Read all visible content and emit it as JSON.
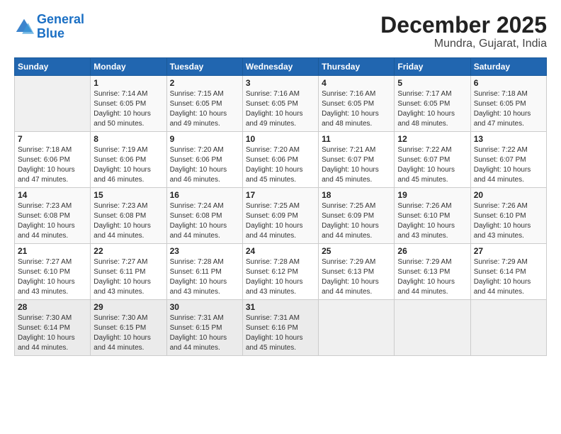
{
  "header": {
    "logo_line1": "General",
    "logo_line2": "Blue",
    "title": "December 2025",
    "subtitle": "Mundra, Gujarat, India"
  },
  "days_of_week": [
    "Sunday",
    "Monday",
    "Tuesday",
    "Wednesday",
    "Thursday",
    "Friday",
    "Saturday"
  ],
  "weeks": [
    [
      {
        "day": "",
        "info": ""
      },
      {
        "day": "1",
        "info": "Sunrise: 7:14 AM\nSunset: 6:05 PM\nDaylight: 10 hours\nand 50 minutes."
      },
      {
        "day": "2",
        "info": "Sunrise: 7:15 AM\nSunset: 6:05 PM\nDaylight: 10 hours\nand 49 minutes."
      },
      {
        "day": "3",
        "info": "Sunrise: 7:16 AM\nSunset: 6:05 PM\nDaylight: 10 hours\nand 49 minutes."
      },
      {
        "day": "4",
        "info": "Sunrise: 7:16 AM\nSunset: 6:05 PM\nDaylight: 10 hours\nand 48 minutes."
      },
      {
        "day": "5",
        "info": "Sunrise: 7:17 AM\nSunset: 6:05 PM\nDaylight: 10 hours\nand 48 minutes."
      },
      {
        "day": "6",
        "info": "Sunrise: 7:18 AM\nSunset: 6:05 PM\nDaylight: 10 hours\nand 47 minutes."
      }
    ],
    [
      {
        "day": "7",
        "info": "Sunrise: 7:18 AM\nSunset: 6:06 PM\nDaylight: 10 hours\nand 47 minutes."
      },
      {
        "day": "8",
        "info": "Sunrise: 7:19 AM\nSunset: 6:06 PM\nDaylight: 10 hours\nand 46 minutes."
      },
      {
        "day": "9",
        "info": "Sunrise: 7:20 AM\nSunset: 6:06 PM\nDaylight: 10 hours\nand 46 minutes."
      },
      {
        "day": "10",
        "info": "Sunrise: 7:20 AM\nSunset: 6:06 PM\nDaylight: 10 hours\nand 45 minutes."
      },
      {
        "day": "11",
        "info": "Sunrise: 7:21 AM\nSunset: 6:07 PM\nDaylight: 10 hours\nand 45 minutes."
      },
      {
        "day": "12",
        "info": "Sunrise: 7:22 AM\nSunset: 6:07 PM\nDaylight: 10 hours\nand 45 minutes."
      },
      {
        "day": "13",
        "info": "Sunrise: 7:22 AM\nSunset: 6:07 PM\nDaylight: 10 hours\nand 44 minutes."
      }
    ],
    [
      {
        "day": "14",
        "info": "Sunrise: 7:23 AM\nSunset: 6:08 PM\nDaylight: 10 hours\nand 44 minutes."
      },
      {
        "day": "15",
        "info": "Sunrise: 7:23 AM\nSunset: 6:08 PM\nDaylight: 10 hours\nand 44 minutes."
      },
      {
        "day": "16",
        "info": "Sunrise: 7:24 AM\nSunset: 6:08 PM\nDaylight: 10 hours\nand 44 minutes."
      },
      {
        "day": "17",
        "info": "Sunrise: 7:25 AM\nSunset: 6:09 PM\nDaylight: 10 hours\nand 44 minutes."
      },
      {
        "day": "18",
        "info": "Sunrise: 7:25 AM\nSunset: 6:09 PM\nDaylight: 10 hours\nand 44 minutes."
      },
      {
        "day": "19",
        "info": "Sunrise: 7:26 AM\nSunset: 6:10 PM\nDaylight: 10 hours\nand 43 minutes."
      },
      {
        "day": "20",
        "info": "Sunrise: 7:26 AM\nSunset: 6:10 PM\nDaylight: 10 hours\nand 43 minutes."
      }
    ],
    [
      {
        "day": "21",
        "info": "Sunrise: 7:27 AM\nSunset: 6:10 PM\nDaylight: 10 hours\nand 43 minutes."
      },
      {
        "day": "22",
        "info": "Sunrise: 7:27 AM\nSunset: 6:11 PM\nDaylight: 10 hours\nand 43 minutes."
      },
      {
        "day": "23",
        "info": "Sunrise: 7:28 AM\nSunset: 6:11 PM\nDaylight: 10 hours\nand 43 minutes."
      },
      {
        "day": "24",
        "info": "Sunrise: 7:28 AM\nSunset: 6:12 PM\nDaylight: 10 hours\nand 43 minutes."
      },
      {
        "day": "25",
        "info": "Sunrise: 7:29 AM\nSunset: 6:13 PM\nDaylight: 10 hours\nand 44 minutes."
      },
      {
        "day": "26",
        "info": "Sunrise: 7:29 AM\nSunset: 6:13 PM\nDaylight: 10 hours\nand 44 minutes."
      },
      {
        "day": "27",
        "info": "Sunrise: 7:29 AM\nSunset: 6:14 PM\nDaylight: 10 hours\nand 44 minutes."
      }
    ],
    [
      {
        "day": "28",
        "info": "Sunrise: 7:30 AM\nSunset: 6:14 PM\nDaylight: 10 hours\nand 44 minutes."
      },
      {
        "day": "29",
        "info": "Sunrise: 7:30 AM\nSunset: 6:15 PM\nDaylight: 10 hours\nand 44 minutes."
      },
      {
        "day": "30",
        "info": "Sunrise: 7:31 AM\nSunset: 6:15 PM\nDaylight: 10 hours\nand 44 minutes."
      },
      {
        "day": "31",
        "info": "Sunrise: 7:31 AM\nSunset: 6:16 PM\nDaylight: 10 hours\nand 45 minutes."
      },
      {
        "day": "",
        "info": ""
      },
      {
        "day": "",
        "info": ""
      },
      {
        "day": "",
        "info": ""
      }
    ]
  ]
}
